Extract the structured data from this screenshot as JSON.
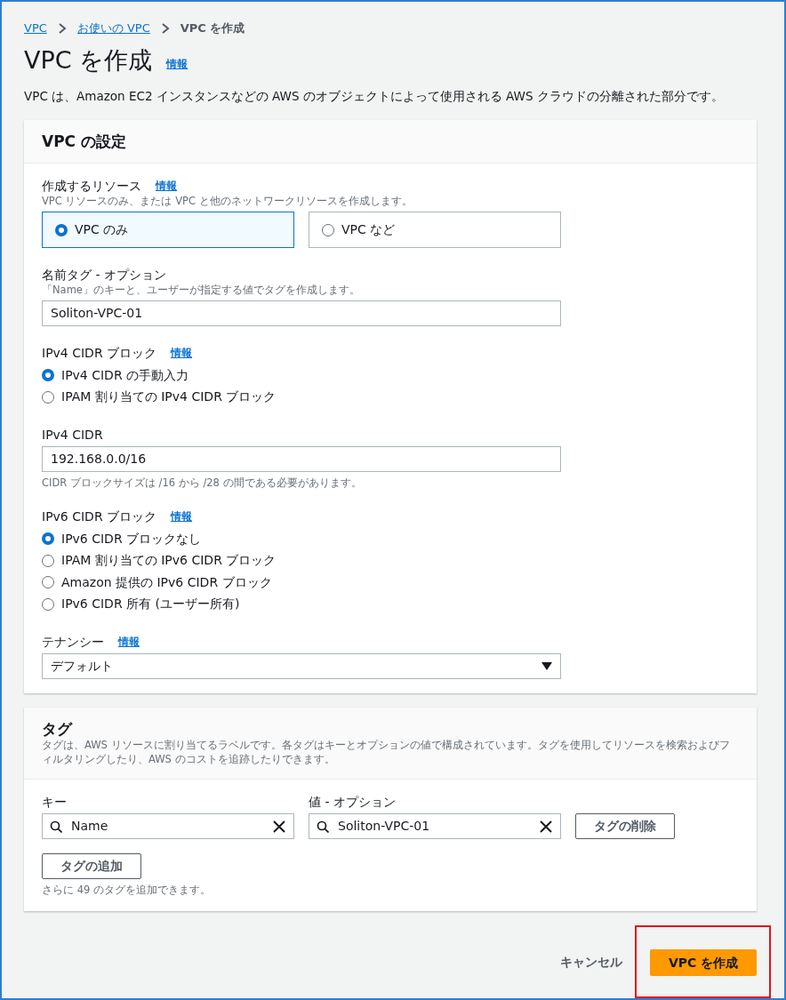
{
  "breadcrumb": [
    {
      "label": "VPC",
      "link": true
    },
    {
      "label": "お使いの VPC",
      "link": true
    },
    {
      "label": "VPC を作成",
      "link": false
    }
  ],
  "page": {
    "title": "VPC を作成",
    "info": "情報",
    "description": "VPC は、Amazon EC2 インスタンスなどの AWS のオブジェクトによって使用される AWS クラウドの分離された部分です。"
  },
  "settings": {
    "title": "VPC の設定",
    "fields": [
      {
        "kind": "tiles",
        "label": "作成するリソース",
        "info": "情報",
        "hint": "VPC リソースのみ、または VPC と他のネットワークリソースを作成します。",
        "options": [
          {
            "label": "VPC のみ",
            "selected": true
          },
          {
            "label": "VPC など",
            "selected": false
          }
        ]
      },
      {
        "kind": "text",
        "label": "名前タグ - オプション",
        "hint": "「Name」のキーと、ユーザーが指定する値でタグを作成します。",
        "value": "Soliton-VPC-01"
      },
      {
        "kind": "radios",
        "label": "IPv4 CIDR ブロック",
        "info": "情報",
        "options": [
          {
            "label": "IPv4 CIDR の手動入力",
            "selected": true
          },
          {
            "label": "IPAM 割り当ての IPv4 CIDR ブロック",
            "selected": false
          }
        ]
      },
      {
        "kind": "text",
        "label": "IPv4 CIDR",
        "value": "192.168.0.0/16",
        "help": "CIDR ブロックサイズは /16 から /28 の間である必要があります。"
      },
      {
        "kind": "radios",
        "label": "IPv6 CIDR ブロック",
        "info": "情報",
        "options": [
          {
            "label": "IPv6 CIDR ブロックなし",
            "selected": true
          },
          {
            "label": "IPAM 割り当ての IPv6 CIDR ブロック",
            "selected": false
          },
          {
            "label": "Amazon 提供の IPv6 CIDR ブロック",
            "selected": false
          },
          {
            "label": "IPv6 CIDR 所有 (ユーザー所有)",
            "selected": false
          }
        ]
      },
      {
        "kind": "select",
        "label": "テナンシー",
        "info": "情報",
        "value": "デフォルト"
      }
    ]
  },
  "tags": {
    "title": "タグ",
    "description": "タグは、AWS リソースに割り当てるラベルです。各タグはキーとオプションの値で構成されています。タグを使用してリソースを検索およびフィルタリングしたり、AWS のコストを追跡したりできます。",
    "key_label": "キー",
    "value_label": "値 - オプション",
    "rows": [
      {
        "key": "Name",
        "value": "Soliton-VPC-01",
        "remove": "タグの削除"
      }
    ],
    "add_button": "タグの追加",
    "limit_note": "さらに 49 のタグを追加できます。"
  },
  "actions": {
    "cancel": "キャンセル",
    "submit": "VPC を作成",
    "highlighted": true
  }
}
